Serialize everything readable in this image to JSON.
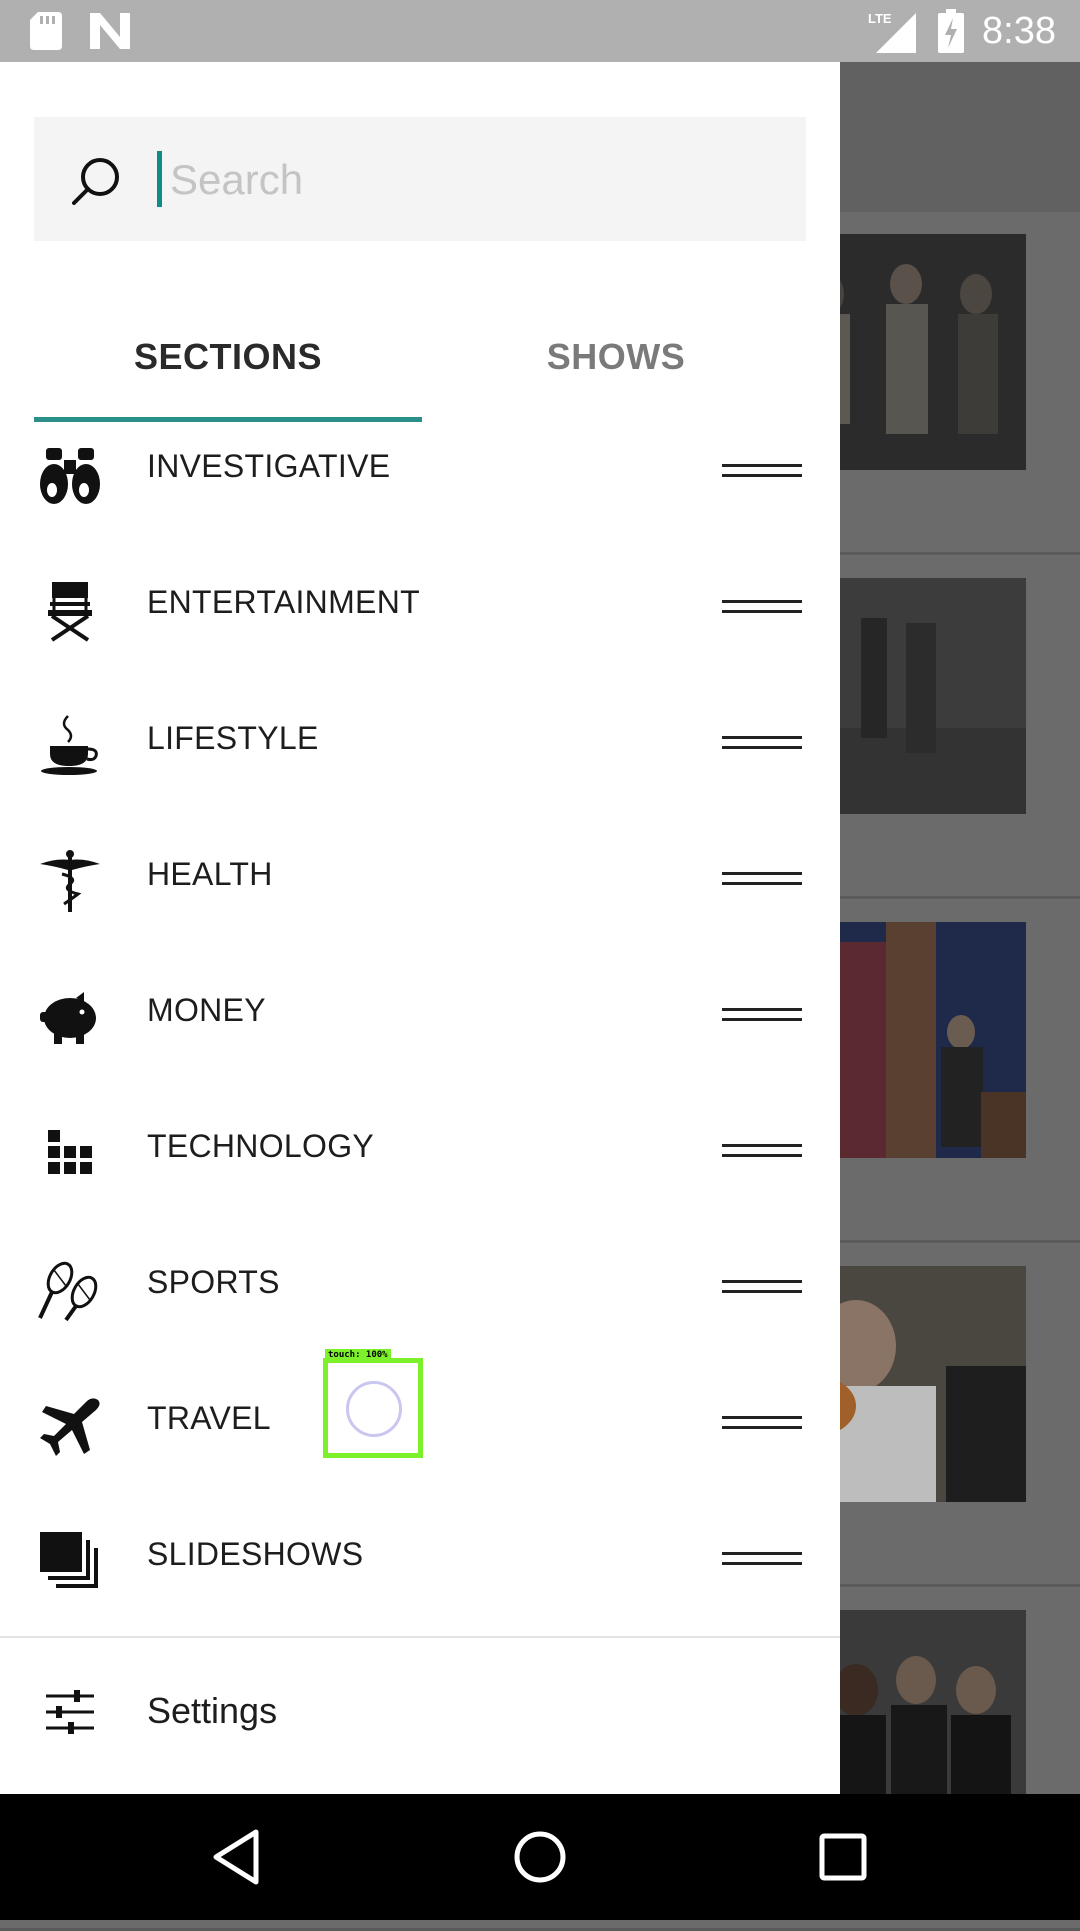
{
  "status_bar": {
    "time": "8:38",
    "network": "LTE",
    "icons": [
      "sd-card-icon",
      "n-logo-icon",
      "lte-signal-icon",
      "battery-charging-icon"
    ]
  },
  "search": {
    "placeholder": "Search",
    "value": ""
  },
  "tabs": [
    {
      "label": "SECTIONS",
      "selected": true
    },
    {
      "label": "SHOWS",
      "selected": false
    }
  ],
  "sections": [
    {
      "label": "INVESTIGATIVE",
      "icon": "binoculars-icon"
    },
    {
      "label": "ENTERTAINMENT",
      "icon": "directors-chair-icon"
    },
    {
      "label": "LIFESTYLE",
      "icon": "coffee-cup-icon"
    },
    {
      "label": "HEALTH",
      "icon": "caduceus-icon"
    },
    {
      "label": "MONEY",
      "icon": "piggy-bank-icon"
    },
    {
      "label": "TECHNOLOGY",
      "icon": "grid-blocks-icon"
    },
    {
      "label": "SPORTS",
      "icon": "tennis-rackets-icon"
    },
    {
      "label": "TRAVEL",
      "icon": "airplane-icon"
    },
    {
      "label": "SLIDESHOWS",
      "icon": "stacked-slides-icon"
    }
  ],
  "settings": {
    "label": "Settings",
    "icon": "sliders-icon"
  },
  "touch_indicator": {
    "label": "touch: 100%"
  },
  "colors": {
    "accent": "#2a8f8a",
    "touch": "#7cf02a"
  }
}
